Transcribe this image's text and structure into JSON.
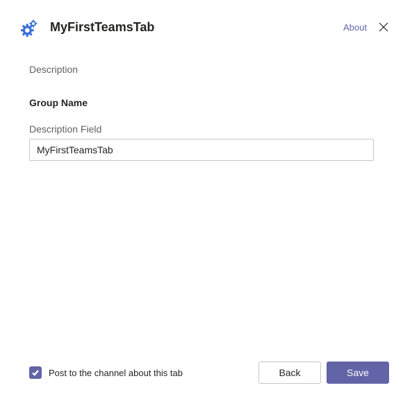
{
  "header": {
    "title": "MyFirstTeamsTab",
    "about_label": "About"
  },
  "content": {
    "description": "Description",
    "group_name": "Group Name",
    "field_label": "Description Field",
    "field_value": "MyFirstTeamsTab"
  },
  "footer": {
    "checkbox_label": "Post to the channel about this tab",
    "checkbox_checked": true,
    "back_label": "Back",
    "save_label": "Save"
  },
  "colors": {
    "accent": "#6264a7"
  }
}
